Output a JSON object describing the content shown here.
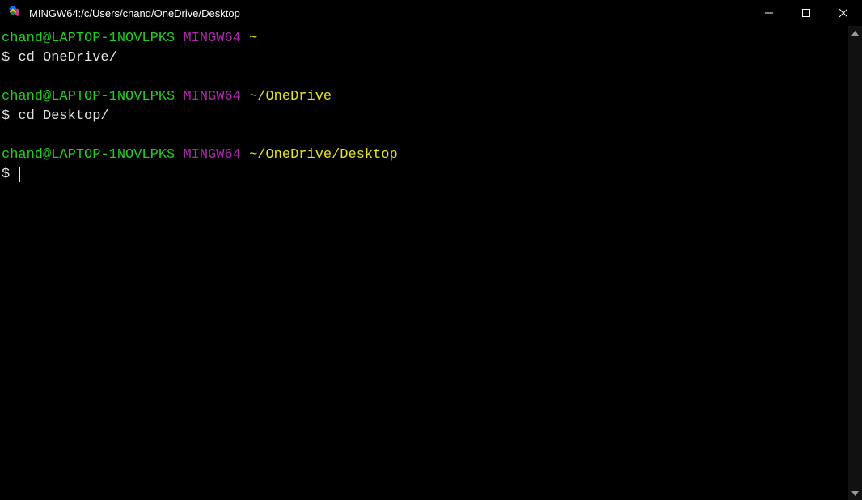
{
  "titlebar": {
    "title": "MINGW64:/c/Users/chand/OneDrive/Desktop"
  },
  "prompts": [
    {
      "user_host": "chand@LAPTOP-1NOVLPKS",
      "env": "MINGW64",
      "cwd": "~",
      "dollar": "$",
      "cmd": "cd OneDrive/"
    },
    {
      "user_host": "chand@LAPTOP-1NOVLPKS",
      "env": "MINGW64",
      "cwd": "~/OneDrive",
      "dollar": "$",
      "cmd": "cd Desktop/"
    },
    {
      "user_host": "chand@LAPTOP-1NOVLPKS",
      "env": "MINGW64",
      "cwd": "~/OneDrive/Desktop",
      "dollar": "$",
      "cmd": ""
    }
  ]
}
